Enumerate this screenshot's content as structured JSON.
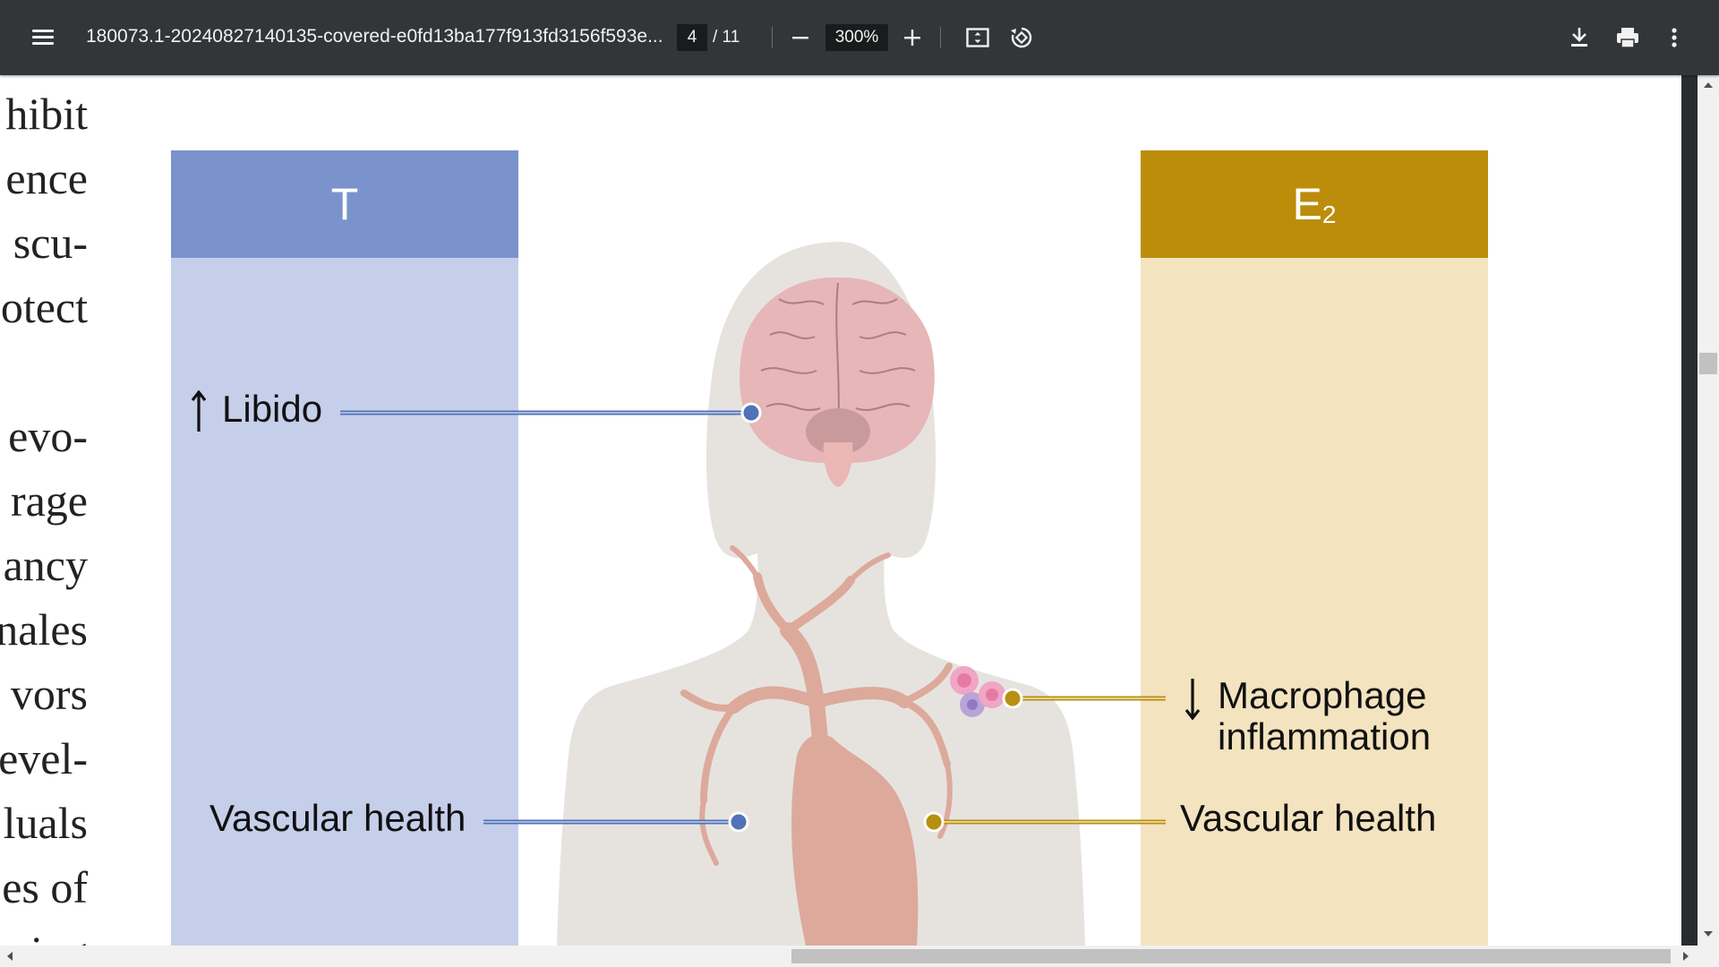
{
  "toolbar": {
    "menu_icon": "hamburger-menu-icon",
    "title": "180073.1-20240827140135-covered-e0fd13ba177f913fd3156f593e...",
    "page_current": "4",
    "page_total": "/ 11",
    "zoom": "300%",
    "icons": [
      "zoom-out-icon",
      "zoom-in-icon",
      "fit-page-icon",
      "rotate-icon",
      "download-icon",
      "print-icon",
      "more-vert-icon"
    ]
  },
  "document": {
    "text_fragments": [
      "hibit",
      "ence",
      "scu-",
      "otect",
      "evo-",
      "rage",
      "ancy",
      "nales",
      "vors",
      "evel-",
      "luals",
      "es of",
      "ning"
    ]
  },
  "figure": {
    "left_header": "T",
    "right_header": "E",
    "right_header_sub": "2",
    "labels": {
      "libido": "Libido",
      "vascular_left": "Vascular health",
      "macrophage_1": "Macrophage",
      "macrophage_2": "inflammation",
      "vascular_right": "Vascular health"
    },
    "colors": {
      "t_header": "#7b93cc",
      "t_body": "#c6cfea",
      "e2_header": "#bb8d0b",
      "e2_body": "#f4e3bf",
      "blue_line": "#4f72b8",
      "gold_line": "#b7900f",
      "silhouette": "#e6e3df",
      "heart": "#dda99b"
    }
  }
}
